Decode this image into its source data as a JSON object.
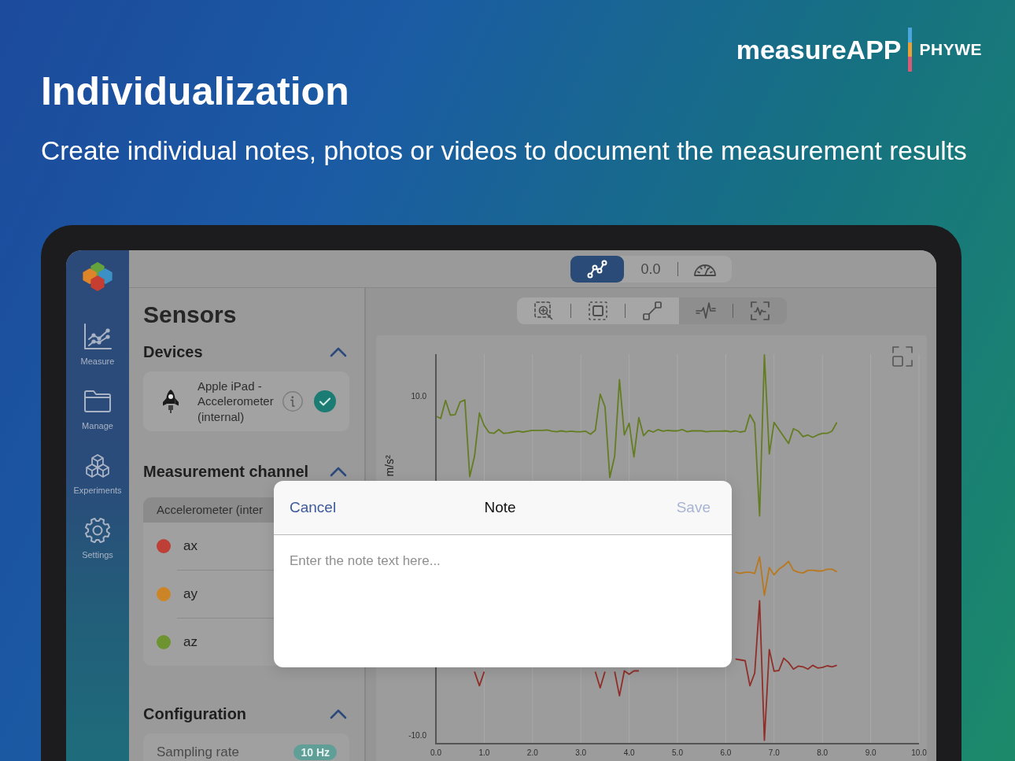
{
  "heading": {
    "title": "Individualization",
    "subtitle": "Create individual notes, photos or videos to document the measurement results"
  },
  "logo": {
    "product": "measureAPP",
    "brand": "PHYWE"
  },
  "sidebar": {
    "items": [
      {
        "kind": "measure",
        "label": "Measure"
      },
      {
        "kind": "manage",
        "label": "Manage"
      },
      {
        "kind": "experiments",
        "label": "Experiments"
      },
      {
        "kind": "settings",
        "label": "Settings"
      }
    ]
  },
  "view_switch": [
    {
      "kind": "graph",
      "selected": true
    },
    {
      "kind": "value",
      "label": "0.0",
      "selected": false
    },
    {
      "kind": "gauge",
      "selected": false
    }
  ],
  "sensors": {
    "title": "Sensors",
    "sections": [
      {
        "kind": "devices",
        "heading": "Devices",
        "expanded": true,
        "devices": [
          {
            "name": "Apple iPad - Accelerometer (internal)",
            "checked": true
          }
        ]
      },
      {
        "kind": "channels",
        "heading": "Measurement channel",
        "expanded": true,
        "group": "Accelerometer (inter",
        "channels": [
          {
            "name": "ax",
            "color": "#bd3f38"
          },
          {
            "name": "ay",
            "color": "#cc8526"
          },
          {
            "name": "az",
            "color": "#6d9430"
          }
        ]
      },
      {
        "kind": "configuration",
        "heading": "Configuration",
        "expanded": true,
        "rows": [
          {
            "label": "Sampling rate",
            "value": "10 Hz",
            "disabled": true
          }
        ]
      }
    ]
  },
  "toolbar": {
    "groups": [
      {
        "selected": false,
        "tools": [
          {
            "kind": "zoom"
          },
          {
            "kind": "frame"
          },
          {
            "kind": "line"
          }
        ]
      },
      {
        "selected": true,
        "tools": [
          {
            "kind": "wave"
          },
          {
            "kind": "framed-wave"
          }
        ]
      }
    ]
  },
  "chart": {
    "chart_data": {
      "type": "line",
      "ylabel": "m/s²",
      "grid": true,
      "x": [
        0,
        0.1,
        0.2,
        0.3,
        0.4,
        0.5,
        0.6,
        0.7,
        0.8,
        0.9,
        1,
        1.1,
        1.2,
        1.3,
        1.4,
        1.5,
        1.6,
        1.7,
        1.8,
        1.9,
        2,
        2.1,
        2.2,
        2.3,
        2.4,
        2.5,
        2.6,
        2.7,
        2.8,
        2.9,
        3,
        3.1,
        3.2,
        3.3,
        3.4,
        3.5,
        3.6,
        3.7,
        3.8,
        3.9,
        4,
        4.1,
        4.2,
        4.3,
        4.4,
        4.5,
        4.6,
        4.7,
        4.8,
        4.9,
        5,
        5.1,
        5.2,
        5.3,
        5.4,
        5.5,
        5.6,
        5.7,
        5.8,
        5.9,
        6,
        6.1,
        6.2,
        6.3,
        6.4,
        6.5,
        6.6,
        6.7,
        6.8,
        6.9,
        7,
        7.1,
        7.2,
        7.3,
        7.4,
        7.5,
        7.6,
        7.7,
        7.8,
        7.9,
        8,
        8.1,
        8.2,
        8.3
      ],
      "series": [
        {
          "color": "#902f29",
          "values": [
            null,
            null,
            null,
            null,
            null,
            null,
            null,
            null,
            -6.25,
            -7.08,
            -6.25,
            null,
            null,
            null,
            null,
            null,
            null,
            null,
            null,
            null,
            null,
            null,
            null,
            null,
            null,
            null,
            null,
            null,
            null,
            null,
            null,
            null,
            null,
            -6.25,
            -7.2,
            -6.25,
            null,
            -6.25,
            -7.67,
            -6.2,
            -6.4,
            -6.2,
            -6.2,
            null,
            null,
            null,
            null,
            null,
            null,
            null,
            null,
            null,
            null,
            null,
            null,
            null,
            null,
            null,
            null,
            null,
            null,
            null,
            -5.5,
            -5.55,
            -5.6,
            -7.08,
            -6.33,
            -2.06,
            -10.3,
            -4.94,
            -6.22,
            -6.18,
            -5.45,
            -5.71,
            -6.1,
            -5.92,
            -5.96,
            -6.1,
            -5.87,
            -6.03,
            -6.0,
            -5.9,
            -5.96,
            -5.87
          ]
        },
        {
          "color": "#b8781f",
          "values": [
            null,
            null,
            null,
            null,
            null,
            null,
            null,
            null,
            null,
            null,
            null,
            null,
            null,
            null,
            null,
            null,
            null,
            null,
            null,
            null,
            null,
            null,
            null,
            null,
            null,
            null,
            null,
            null,
            null,
            null,
            null,
            null,
            null,
            null,
            null,
            null,
            null,
            null,
            null,
            null,
            null,
            null,
            null,
            null,
            null,
            null,
            null,
            null,
            null,
            null,
            null,
            null,
            null,
            null,
            null,
            null,
            null,
            null,
            null,
            null,
            null,
            null,
            -0.38,
            -0.45,
            -0.38,
            -0.38,
            -0.45,
            0.53,
            -1.74,
            -0.1,
            -0.53,
            -0.2,
            0.0,
            0.26,
            -0.26,
            -0.38,
            -0.42,
            -0.26,
            -0.26,
            -0.3,
            -0.3,
            -0.2,
            -0.2,
            -0.35
          ]
        },
        {
          "color": "#647c22",
          "values": [
            8.84,
            8.7,
            9.77,
            8.9,
            8.93,
            9.67,
            9.8,
            5.27,
            6.47,
            9.03,
            8.28,
            7.87,
            7.82,
            8.05,
            7.82,
            7.85,
            7.9,
            7.95,
            7.9,
            7.95,
            8.0,
            8.0,
            8.0,
            8.02,
            7.95,
            7.92,
            7.97,
            7.92,
            7.95,
            7.92,
            7.92,
            7.95,
            7.77,
            8.0,
            10.14,
            9.4,
            5.22,
            6.47,
            11.0,
            7.73,
            8.42,
            6.43,
            8.75,
            7.68,
            8.0,
            7.9,
            8.05,
            7.95,
            8.0,
            7.97,
            7.97,
            8.05,
            7.92,
            7.97,
            7.97,
            7.97,
            7.92,
            7.95,
            7.95,
            7.95,
            7.97,
            7.92,
            7.97,
            7.9,
            7.95,
            8.93,
            8.42,
            2.95,
            12.46,
            6.61,
            8.47,
            8.05,
            7.63,
            7.22,
            8.1,
            7.96,
            7.63,
            7.73,
            7.59,
            7.73,
            7.82,
            7.82,
            7.96,
            8.47
          ]
        }
      ],
      "xlim": [
        0,
        10
      ],
      "ylim": [
        -10.5,
        12.5
      ],
      "xticks": [
        {
          "value": 0,
          "label": "0.0"
        },
        {
          "value": 1,
          "label": "1.0"
        },
        {
          "value": 2,
          "label": "2.0"
        },
        {
          "value": 3,
          "label": "3.0"
        },
        {
          "value": 4,
          "label": "4.0"
        },
        {
          "value": 5,
          "label": "5.0"
        },
        {
          "value": 6,
          "label": "6.0"
        },
        {
          "value": 7,
          "label": "7.0"
        },
        {
          "value": 8,
          "label": "8.0"
        },
        {
          "value": 9,
          "label": "9.0"
        },
        {
          "value": 10,
          "label": "10.0"
        }
      ],
      "yticks": [
        {
          "value": 10,
          "label": "10.0"
        },
        {
          "value": -10,
          "label": "-10.0"
        }
      ]
    }
  },
  "note_dialog": {
    "title": "Note",
    "cancel": "Cancel",
    "save": {
      "label": "Save",
      "disabled": true
    },
    "placeholder": "Enter the note text here..."
  }
}
